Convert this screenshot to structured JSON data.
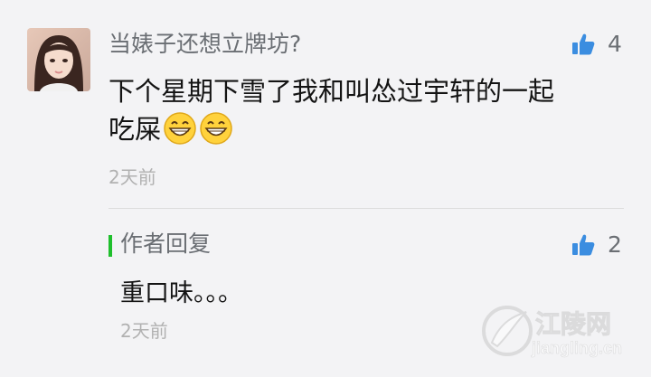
{
  "comment": {
    "username": "当婊子还想立牌坊?",
    "likes": "4",
    "text_line1": "下个星期下雪了我和叫怂过宇轩的一起",
    "text_line2": "吃屎",
    "emoji_count": 2,
    "time": "2天前"
  },
  "reply": {
    "label": "作者回复",
    "likes": "2",
    "text": "重口味。。。",
    "time": "2天前"
  },
  "watermark": {
    "brand": "江陵网",
    "url": "jiangling.cn"
  },
  "colors": {
    "accent_green": "#1fbf2c",
    "like_icon_blue": "#3b8de0"
  },
  "icons": [
    "thumbs-up-icon",
    "grinning-face-emoji",
    "jiangling-logo-icon"
  ]
}
